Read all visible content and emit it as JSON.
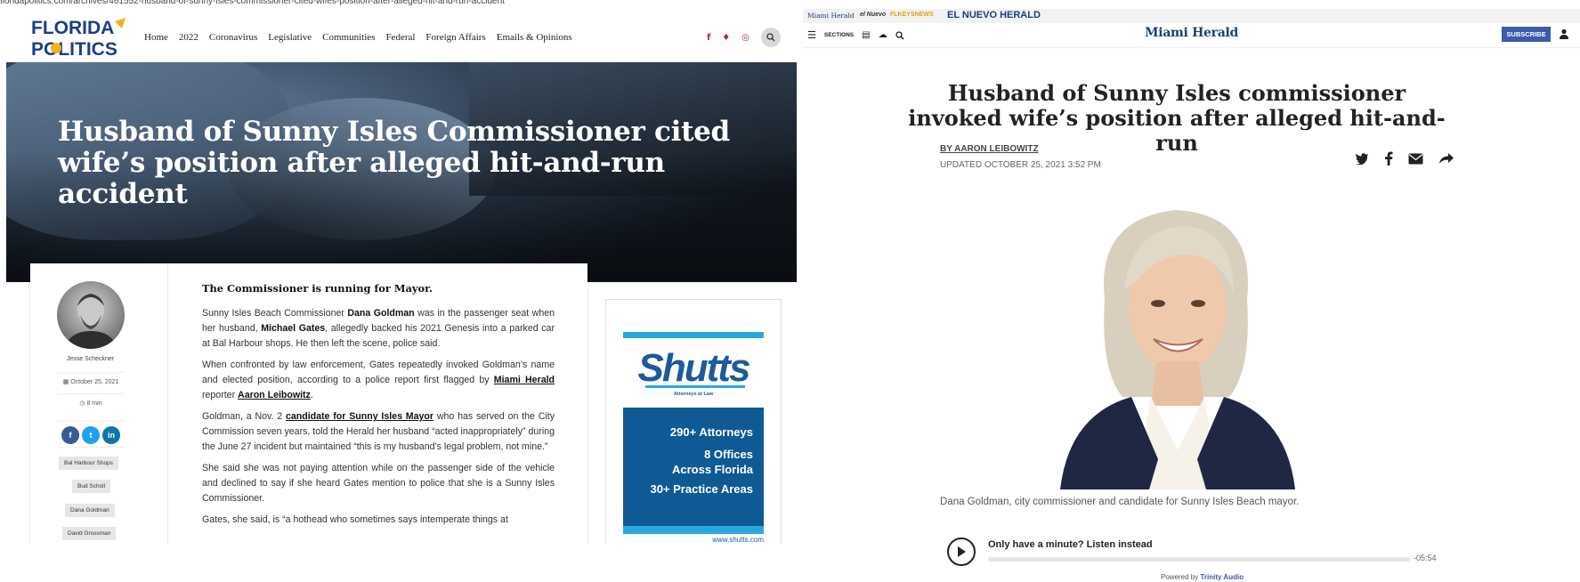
{
  "left_site": {
    "url": "floridapolitics.com/archives/461552-husband-of-sunny-isles-commissioner-cited-wifes-position-after-alleged-hit-and-run-accident",
    "logo": {
      "line1": "FLORIDA",
      "line2": "POLITICS"
    },
    "nav": [
      "Home",
      "2022",
      "Coronavirus",
      "Legislative",
      "Communities",
      "Federal",
      "Foreign Affairs",
      "Emails & Opinions"
    ],
    "social": [
      {
        "icon": "facebook-icon",
        "glyph": "f"
      },
      {
        "icon": "twitter-icon",
        "glyph": "♦"
      },
      {
        "icon": "instagram-icon",
        "glyph": "◎"
      }
    ],
    "headline": "Husband of Sunny Isles Commissioner cited wife’s position after alleged hit-and-run accident",
    "author": {
      "name": "Jesse Scheckner",
      "date": "October 25, 2021",
      "read_time": "8 min"
    },
    "share": [
      {
        "icon": "facebook-icon",
        "glyph": "f",
        "color": "#3b5998"
      },
      {
        "icon": "twitter-icon",
        "glyph": "t",
        "color": "#1da1f2"
      },
      {
        "icon": "linkedin-icon",
        "glyph": "in",
        "color": "#0e76a8"
      }
    ],
    "tags": [
      "Bal Harbour Shops",
      "Bud Scholl",
      "Dana Goldman",
      "David Grossman"
    ],
    "body": {
      "lead": "The Commissioner is running for Mayor.",
      "p1": {
        "t1": "Sunny Isles Beach Commissioner ",
        "b1": "Dana Goldman",
        "t2": " was in the passenger seat when her husband, ",
        "b2": "Michael Gates",
        "t3": ", allegedly backed his 2021 Genesis into a parked car at Bal Harbour shops. He then left the scene, police said."
      },
      "p2": {
        "t1": "When confronted by law enforcement, Gates repeatedly invoked Goldman’s name and elected position, according to a police report first flagged by ",
        "l1": "Miami Herald",
        "t2": " reporter ",
        "l2": "Aaron Leibowitz",
        "t3": "."
      },
      "p3": {
        "t1": "Goldman, a Nov. 2 ",
        "l1": "candidate for Sunny Isles Mayor",
        "t2": " who has served on the City Commission seven years, told the Herald her husband “acted inappropriately” during the June 27 incident but maintained “this is my husband’s legal problem, not mine.”"
      },
      "p4": "She said she was not paying attention while on the passenger side of the vehicle and declined to say if she heard Gates mention to police that she is a Sunny Isles Commissioner.",
      "p5": "Gates, she said, is “a hothead who sometimes says intemperate things at"
    },
    "ad": {
      "logo": "Shutts",
      "tagline": "Attorneys at Law",
      "line1": "290+ Attorneys",
      "line2a": "8 Offices",
      "line2b": "Across Florida",
      "line3": "30+ Practice Areas",
      "url": "www.shutts.com"
    }
  },
  "right_site": {
    "brands": [
      {
        "label": "Miami Herald",
        "color": "#1c3f7a"
      },
      {
        "label": "el Nuevo",
        "color": "#333333"
      },
      {
        "label": "FLKEYSNEWS",
        "color": "#e0a21b"
      },
      {
        "label": "EL NUEVO HERALD",
        "color": "#1a3c82"
      }
    ],
    "sections_label": "SECTIONS",
    "logo": "Miami Herald",
    "subscribe": "SUBSCRIBE",
    "headline": "Husband of Sunny Isles commissioner invoked wife’s position after alleged hit-and-run",
    "byline": "BY AARON LEIBOWITZ",
    "updated": "UPDATED OCTOBER 25, 2021 3:52 PM",
    "share_icons": [
      "twitter-icon",
      "facebook-icon",
      "email-icon",
      "share-arrow-icon"
    ],
    "caption": "Dana Goldman, city commissioner and candidate for Sunny Isles Beach mayor.",
    "audio": {
      "title": "Only have a minute? Listen instead",
      "time": "-05:54",
      "powered_prefix": "Powered by",
      "powered_brand": "Trinity Audio"
    }
  }
}
